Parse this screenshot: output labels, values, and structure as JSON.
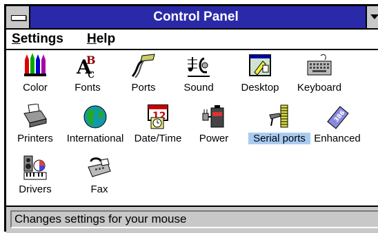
{
  "window": {
    "title": "Control Panel"
  },
  "menu": [
    {
      "label": "Settings",
      "accel": "S",
      "rest": "ettings"
    },
    {
      "label": "Help",
      "accel": "H",
      "rest": "elp"
    }
  ],
  "icons": [
    {
      "label": "Color",
      "icon": "color-icon"
    },
    {
      "label": "Fonts",
      "icon": "fonts-icon"
    },
    {
      "label": "Ports",
      "icon": "ports-icon"
    },
    {
      "label": "Sound",
      "icon": "sound-icon"
    },
    {
      "label": "Desktop",
      "icon": "desktop-icon"
    },
    {
      "label": "Keyboard",
      "icon": "keyboard-icon"
    },
    {
      "label": "Printers",
      "icon": "printers-icon"
    },
    {
      "label": "International",
      "icon": "international-icon"
    },
    {
      "label": "Date/Time",
      "icon": "date-time-icon"
    },
    {
      "label": "Power",
      "icon": "power-icon"
    },
    {
      "label": "Serial ports",
      "icon": "serial-ports-icon",
      "selected": true
    },
    {
      "label": "Enhanced",
      "icon": "enhanced-icon"
    },
    {
      "label": "Drivers",
      "icon": "drivers-icon"
    },
    {
      "label": "Fax",
      "icon": "fax-icon"
    }
  ],
  "status": {
    "text": "Changes settings for your mouse"
  },
  "colors": {
    "titlebar": "#2a2aa8",
    "selection": "#a9cbf2",
    "chrome": "#c8c8c8"
  }
}
